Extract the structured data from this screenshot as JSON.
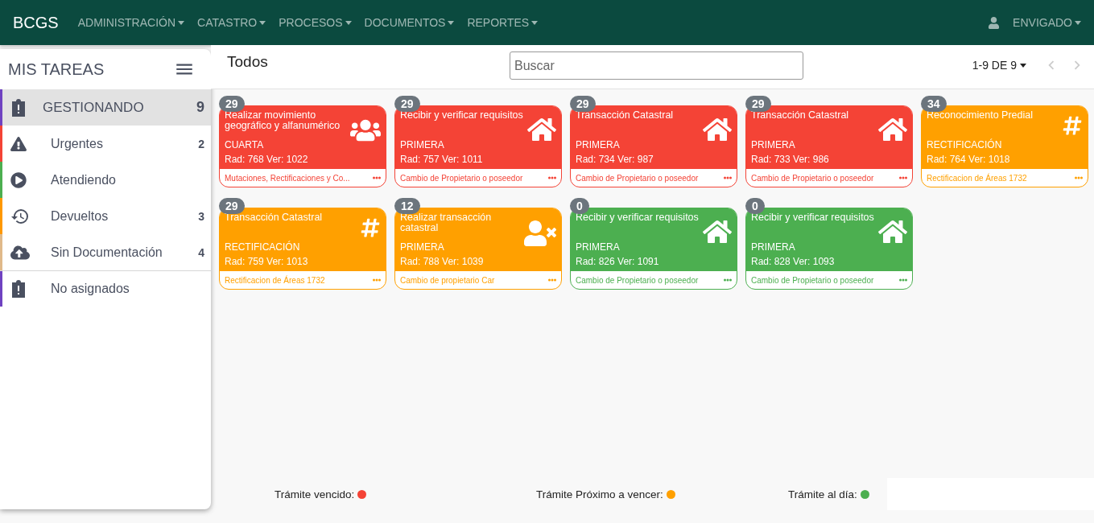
{
  "navbar": {
    "brand": "BCGS",
    "menus": [
      "ADMINISTRACIÓN",
      "CATASTRO",
      "PROCESOS",
      "DOCUMENTOS",
      "REPORTES"
    ],
    "user": "ENVIGADO"
  },
  "sidebar": {
    "title": "MIS TAREAS",
    "items": [
      {
        "label": "GESTIONANDO",
        "count": "9",
        "kind": "clipboard",
        "color": "#6f42c1",
        "selected": true
      },
      {
        "label": "Urgentes",
        "count": "2",
        "kind": "warning",
        "color": "#f44336",
        "selected": false
      },
      {
        "label": "Atendiendo",
        "kind": "play",
        "color": "#4caf50",
        "selected": false
      },
      {
        "label": "Devueltos",
        "count": "3",
        "kind": "restore",
        "color": "#ff9800",
        "selected": false
      },
      {
        "label": "Sin Documentación",
        "count": "4",
        "kind": "upload",
        "color": "#e0b98a",
        "selected": false
      },
      {
        "label": "No asignados",
        "kind": "clipboard",
        "color": "#6f42c1",
        "selected": false
      }
    ]
  },
  "header": {
    "title": "Todos",
    "search": {
      "placeholder": "Buscar"
    },
    "pagination": "1-9 DE 9"
  },
  "cards": [
    {
      "count": "29",
      "title": "Realizar movimiento geográfico y alfanumérico",
      "kind": "users",
      "type": "CUARTA",
      "rad": "Rad: 768 Ver: 1022",
      "footer": "Mutaciones, Rectificaciones y Co...",
      "color": "#f44336"
    },
    {
      "count": "29",
      "title": "Recibir y verificar requisitos",
      "kind": "home",
      "type": "PRIMERA",
      "rad": "Rad: 757 Ver: 1011",
      "footer": "Cambio de Propietario o poseedor",
      "color": "#f44336"
    },
    {
      "count": "29",
      "title": "Transacción Catastral",
      "kind": "home",
      "type": "PRIMERA",
      "rad": "Rad: 734 Ver: 987",
      "footer": "Cambio de Propietario o poseedor",
      "color": "#f44336"
    },
    {
      "count": "29",
      "title": "Transacción Catastral",
      "kind": "home",
      "type": "PRIMERA",
      "rad": "Rad: 733 Ver: 986",
      "footer": "Cambio de Propietario o poseedor",
      "color": "#f44336"
    },
    {
      "count": "34",
      "title": "Reconocimiento Predial",
      "kind": "hashtag",
      "type": "RECTIFICACIÓN",
      "rad": "Rad: 764 Ver: 1018",
      "footer": "Rectificacion de Áreas 1732",
      "color": "#ffa000"
    },
    {
      "count": "29",
      "title": "Transacción Catastral",
      "kind": "hashtag",
      "type": "RECTIFICACIÓN",
      "rad": "Rad: 759 Ver: 1013",
      "footer": "Rectificacion de Áreas 1732",
      "color": "#ffa000"
    },
    {
      "count": "12",
      "title": "Realizar transacción catastral",
      "kind": "user-x",
      "type": "PRIMERA",
      "rad": "Rad: 788 Ver: 1039",
      "footer": "Cambio de propietario Car",
      "color": "#ffa000"
    },
    {
      "count": "0",
      "title": "Recibir y verificar requisitos",
      "kind": "home",
      "type": "PRIMERA",
      "rad": "Rad: 826 Ver: 1091",
      "footer": "Cambio de Propietario o poseedor",
      "color": "#4caf50"
    },
    {
      "count": "0",
      "title": "Recibir y verificar requisitos",
      "kind": "home",
      "type": "PRIMERA",
      "rad": "Rad: 828 Ver: 1093",
      "footer": "Cambio de Propietario o poseedor",
      "color": "#4caf50"
    }
  ],
  "legend": [
    {
      "label": "Trámite vencido:",
      "color": "#f44336"
    },
    {
      "label": "Trámite Próximo a vencer:",
      "color": "#ffa000"
    },
    {
      "label": "Trámite al día:",
      "color": "#4caf50"
    }
  ]
}
